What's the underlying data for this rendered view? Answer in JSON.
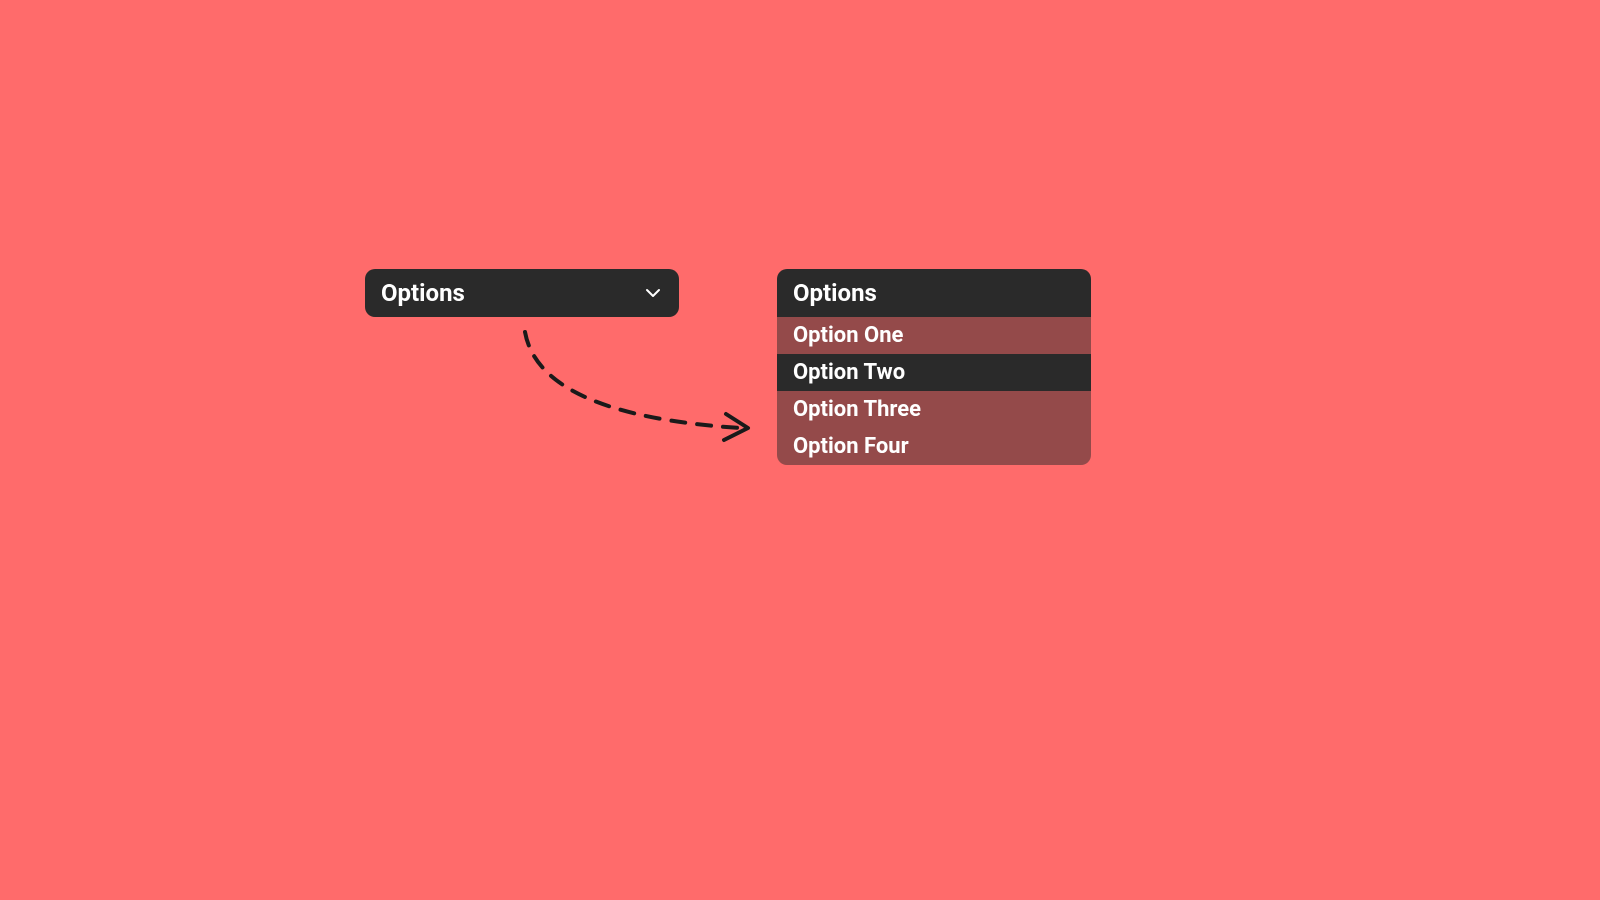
{
  "closed_dropdown": {
    "label": "Options"
  },
  "open_dropdown": {
    "label": "Options",
    "options": [
      {
        "label": "Option One",
        "hovered": false
      },
      {
        "label": "Option Two",
        "hovered": true
      },
      {
        "label": "Option Three",
        "hovered": false
      },
      {
        "label": "Option Four",
        "hovered": false
      }
    ]
  },
  "colors": {
    "background": "#ff6b6b",
    "dropdown_bg": "#2a2a2a",
    "option_bg": "rgba(42,42,42,0.5)",
    "text": "#ffffff"
  }
}
